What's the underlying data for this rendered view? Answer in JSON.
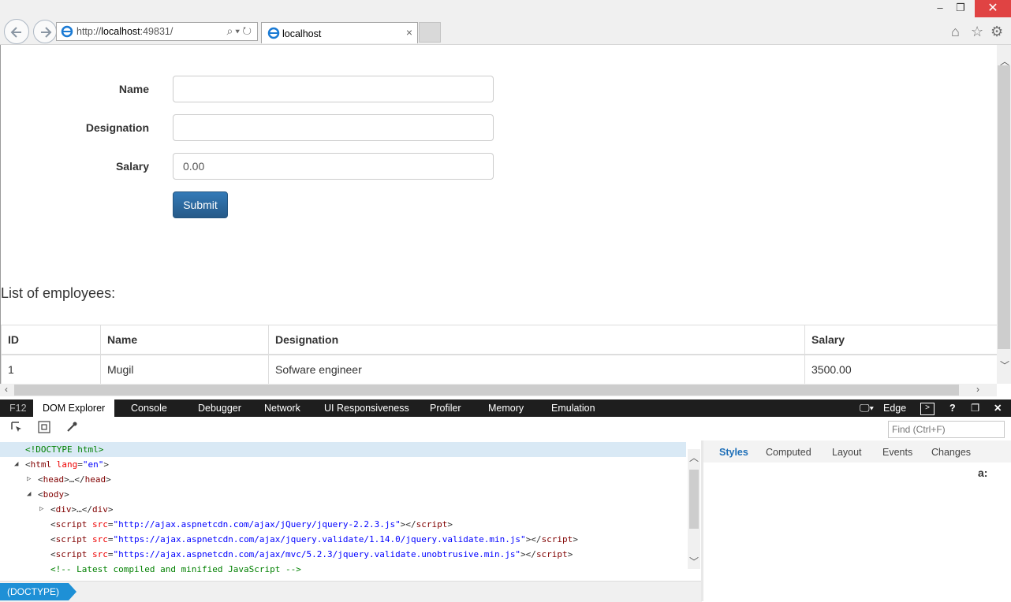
{
  "browser": {
    "url_prefix": "http://",
    "url_host": "localhost",
    "url_rest": ":49831/",
    "tab_title": "localhost",
    "tab_close": "×",
    "window_controls": {
      "minimize": "–",
      "maximize": "❐",
      "close": "✕"
    },
    "address_tools": "⌕▾↻"
  },
  "form": {
    "name_label": "Name",
    "name_value": "",
    "designation_label": "Designation",
    "designation_value": "",
    "salary_label": "Salary",
    "salary_value": "0.00",
    "submit_label": "Submit"
  },
  "list_title": "List of employees:",
  "table": {
    "headers": [
      "ID",
      "Name",
      "Designation",
      "Salary"
    ],
    "rows": [
      [
        "1",
        "Mugil",
        "Sofware engineer",
        "3500.00"
      ]
    ]
  },
  "devtools": {
    "f12": "F12",
    "tabs": [
      "DOM Explorer",
      "Console",
      "Debugger",
      "Network",
      "UI Responsiveness",
      "Profiler",
      "Memory",
      "Emulation"
    ],
    "mode": "Edge",
    "find_placeholder": "Find (Ctrl+F)",
    "styles_tabs": [
      "Styles",
      "Computed",
      "Layout",
      "Events",
      "Changes"
    ],
    "font_icon": "a:",
    "breadcrumb": "(DOCTYPE)",
    "dom_lines": {
      "doctype": "<!DOCTYPE html>",
      "html_open": "html",
      "html_attr": "lang",
      "html_val": "\"en\"",
      "head": "head",
      "body": "body",
      "div": "div",
      "script1": "\"http://ajax.aspnetcdn.com/ajax/jQuery/jquery-2.2.3.js\"",
      "script2": "\"https://ajax.aspnetcdn.com/ajax/jquery.validate/1.14.0/jquery.validate.min.js\"",
      "script3": "\"https://ajax.aspnetcdn.com/ajax/mvc/5.2.3/jquery.validate.unobtrusive.min.js\"",
      "comment": "<!-- Latest compiled and minified JavaScript -->"
    }
  }
}
